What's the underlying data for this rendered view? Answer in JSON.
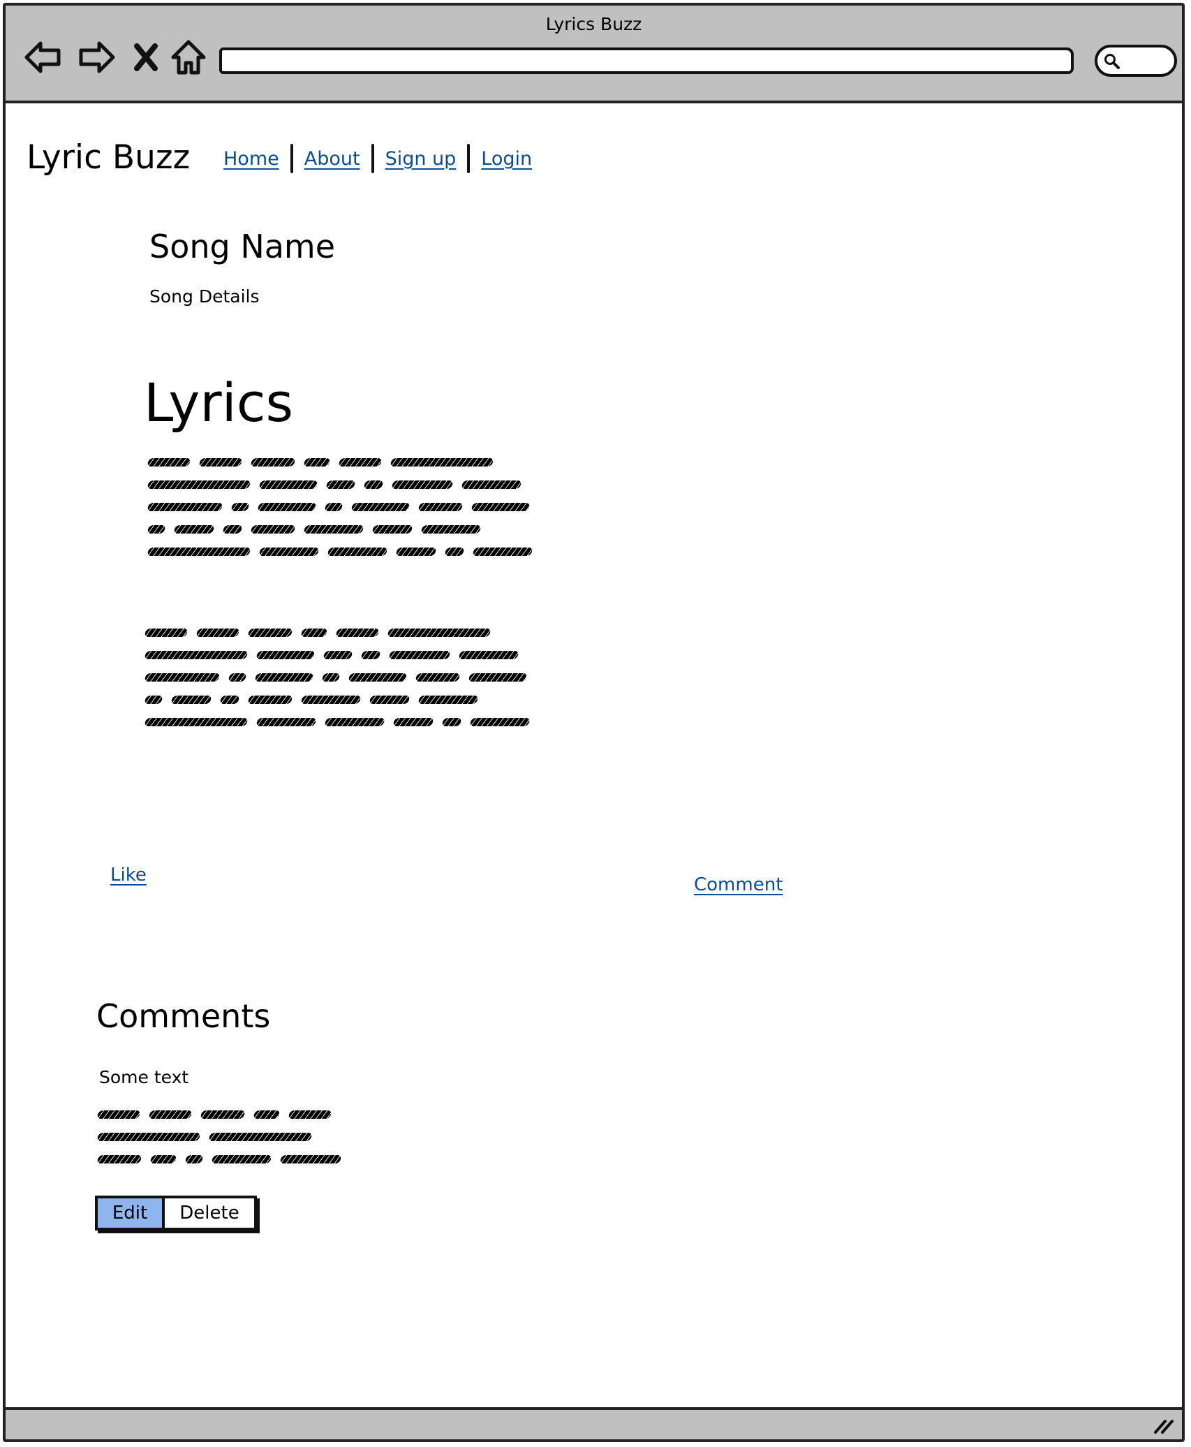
{
  "window": {
    "title": "Lyrics Buzz"
  },
  "browser": {
    "back_icon": "back-arrow-icon",
    "forward_icon": "forward-arrow-icon",
    "stop_icon": "close-x-icon",
    "home_icon": "home-icon",
    "search_icon": "search-icon",
    "address_value": ""
  },
  "site": {
    "brand": "Lyric Buzz",
    "nav": [
      {
        "label": "Home"
      },
      {
        "label": "About"
      },
      {
        "label": "Sign up"
      },
      {
        "label": "Login"
      }
    ]
  },
  "song": {
    "name": "Song Name",
    "details": "Song Details"
  },
  "lyrics": {
    "heading": "Lyrics"
  },
  "actions": {
    "like_label": "Like",
    "comment_label": "Comment"
  },
  "comments": {
    "heading": "Comments",
    "items": [
      {
        "title": "Some text",
        "edit_label": "Edit",
        "delete_label": "Delete"
      }
    ]
  },
  "colors": {
    "chrome": "#c0c0c0",
    "link": "#0b4d94",
    "edit_button": "#8fb5ee"
  }
}
